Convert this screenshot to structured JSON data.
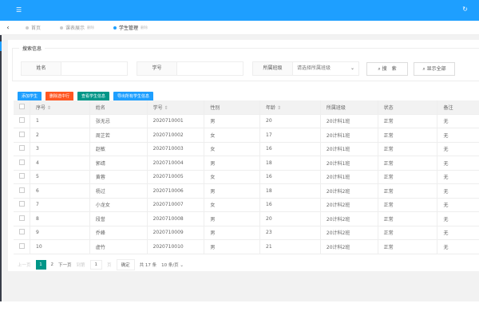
{
  "topbar": {
    "menu_icon": "☰",
    "refresh_icon": "↻"
  },
  "tabs": {
    "back": "‹",
    "items": [
      {
        "label": "首页",
        "close": ""
      },
      {
        "label": "课表展示",
        "close": "删除"
      },
      {
        "label": "学生管理",
        "close": "删除"
      }
    ]
  },
  "search": {
    "legend": "搜索信息",
    "name_label": "姓名",
    "name_value": "",
    "id_label": "学号",
    "id_value": "",
    "class_label": "所属班级",
    "class_placeholder": "请选择所属班级",
    "search_btn": "搜　索",
    "show_all_btn": "显示全部"
  },
  "actions": [
    {
      "label": "添加学生",
      "color": "#1e9fff"
    },
    {
      "label": "删除选中行",
      "color": "#ff5722"
    },
    {
      "label": "查看学生信息",
      "color": "#009688"
    },
    {
      "label": "导出所有学生信息",
      "color": "#1e9fff"
    }
  ],
  "table": {
    "headers": [
      "序号",
      "姓名",
      "学号",
      "性别",
      "年龄",
      "所属班级",
      "状态",
      "备注"
    ],
    "rows": [
      [
        "1",
        "张无忌",
        "2020710001",
        "男",
        "20",
        "20计科1班",
        "正常",
        "无"
      ],
      [
        "2",
        "周芷若",
        "2020710002",
        "女",
        "17",
        "20计科1班",
        "正常",
        "无"
      ],
      [
        "3",
        "赵敏",
        "2020710003",
        "女",
        "16",
        "20计科1班",
        "正常",
        "无"
      ],
      [
        "4",
        "郭靖",
        "2020710004",
        "男",
        "18",
        "20计科1班",
        "正常",
        "无"
      ],
      [
        "5",
        "黄蓉",
        "2020710005",
        "女",
        "16",
        "20计科1班",
        "正常",
        "无"
      ],
      [
        "6",
        "杨过",
        "2020710006",
        "男",
        "18",
        "20计科2班",
        "正常",
        "无"
      ],
      [
        "7",
        "小龙女",
        "2020710007",
        "女",
        "16",
        "20计科2班",
        "正常",
        "无"
      ],
      [
        "8",
        "段誉",
        "2020710008",
        "男",
        "20",
        "20计科2班",
        "正常",
        "无"
      ],
      [
        "9",
        "乔峰",
        "2020710009",
        "男",
        "23",
        "20计科2班",
        "正常",
        "无"
      ],
      [
        "10",
        "虚竹",
        "2020710010",
        "男",
        "21",
        "20计科2班",
        "正常",
        "无"
      ]
    ]
  },
  "pager": {
    "prev": "上一页",
    "p1": "1",
    "p2": "2",
    "next": "下一页",
    "goto": "到第",
    "page_input": "1",
    "page_unit": "页",
    "confirm": "确定",
    "total": "共 17 条",
    "per_page": "10 条/页"
  }
}
